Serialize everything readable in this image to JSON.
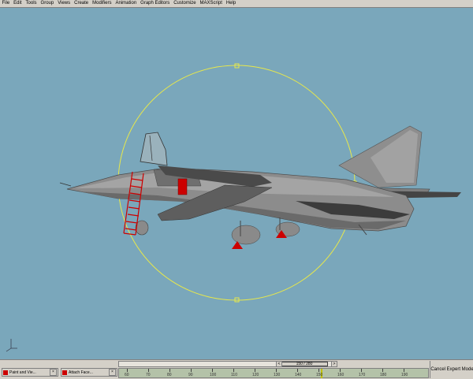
{
  "menu": [
    "File",
    "Edit",
    "Tools",
    "Group",
    "Views",
    "Create",
    "Modifiers",
    "Animation",
    "Graph Editors",
    "Customize",
    "MAXScript",
    "Help"
  ],
  "time_slider": {
    "label": "150 / 280",
    "prev": "<",
    "next": ">",
    "value": 150,
    "max": 280
  },
  "taskbar": [
    {
      "label": "Paint and Vie..."
    },
    {
      "label": "Attach Face..."
    }
  ],
  "track_ticks": [
    "60",
    "70",
    "80",
    "90",
    "100",
    "110",
    "120",
    "130",
    "140",
    "150",
    "160",
    "170",
    "180",
    "190"
  ],
  "expert_mode": "Cancel Expert Mode",
  "colors": {
    "viewport": "#7aa7bb",
    "gizmo": "#e8e84a",
    "selection_red": "#cc0000",
    "aircraft": "#8c8c8c"
  }
}
